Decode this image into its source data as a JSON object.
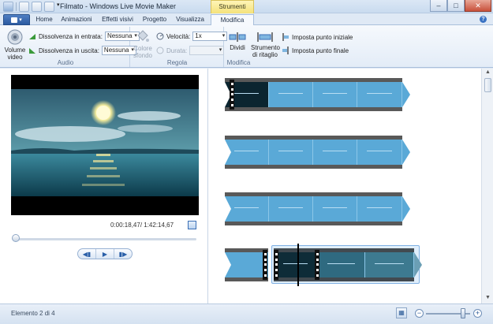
{
  "window": {
    "title": "Filmato - Windows Live Movie Maker",
    "context_tab": "Strumenti video",
    "buttons": {
      "minimize": "–",
      "maximize": "□",
      "close": "✕"
    }
  },
  "tabs": [
    {
      "label": "Home"
    },
    {
      "label": "Animazioni"
    },
    {
      "label": "Effetti visivi"
    },
    {
      "label": "Progetto"
    },
    {
      "label": "Visualizza"
    },
    {
      "label": "Modifica"
    }
  ],
  "ribbon": {
    "audio": {
      "volume_label": "Volume video",
      "fade_in_label": "Dissolvenza in entrata:",
      "fade_in_value": "Nessuna",
      "fade_out_label": "Dissolvenza in uscita:",
      "fade_out_value": "Nessuna",
      "group_label": "Audio"
    },
    "regola": {
      "bg_color_label": "Colore sfondo",
      "speed_label": "Velocità:",
      "speed_value": "1x",
      "duration_label": "Durata:",
      "duration_value": "",
      "group_label": "Regola"
    },
    "modifica": {
      "split_label": "Dividi",
      "trim_label": "Strumento di ritaglio",
      "set_start_label": "Imposta punto iniziale",
      "set_end_label": "Imposta punto finale",
      "group_label": "Modifica"
    }
  },
  "player": {
    "time": "0:00:18,47/ 1:42:14,67",
    "seek_position": 0.01
  },
  "status": {
    "text": "Elemento 2 di 4",
    "zoom_level": 0.85
  },
  "colors": {
    "clip_blue": "#5aa9d7",
    "film_gray": "#595959",
    "accent": "#2b5aa0"
  }
}
